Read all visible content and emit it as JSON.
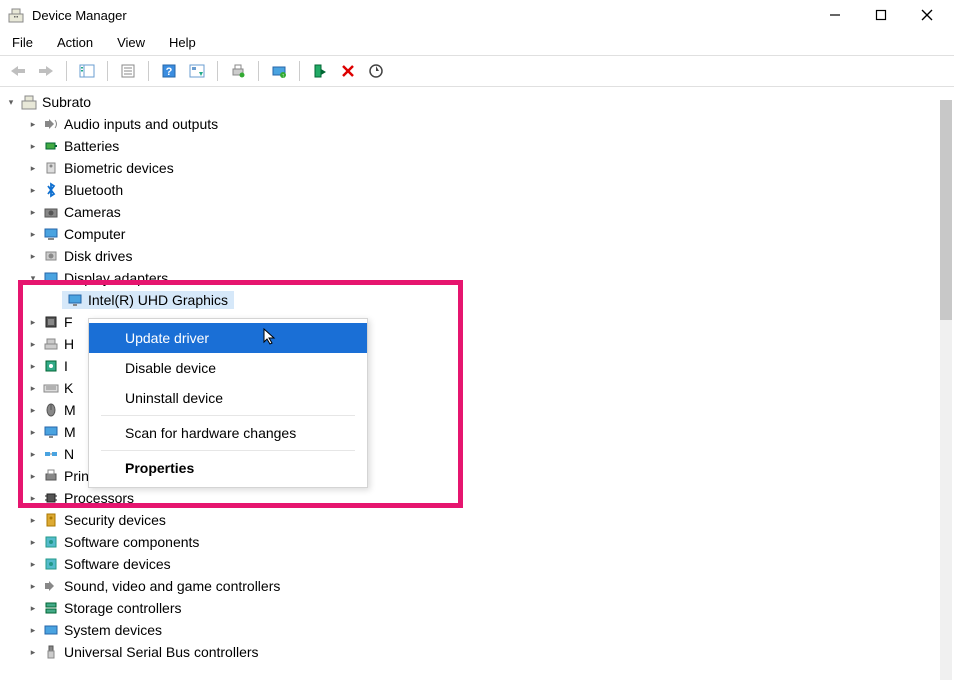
{
  "window": {
    "title": "Device Manager"
  },
  "menubar": [
    "File",
    "Action",
    "View",
    "Help"
  ],
  "tree": {
    "root": "Subrato",
    "selected_device": "Intel(R) UHD Graphics",
    "categories": [
      {
        "label": "Audio inputs and outputs",
        "icon": "audio"
      },
      {
        "label": "Batteries",
        "icon": "battery"
      },
      {
        "label": "Biometric devices",
        "icon": "biometric"
      },
      {
        "label": "Bluetooth",
        "icon": "bluetooth"
      },
      {
        "label": "Cameras",
        "icon": "camera"
      },
      {
        "label": "Computer",
        "icon": "computer"
      },
      {
        "label": "Disk drives",
        "icon": "disk"
      },
      {
        "label": "Display adapters",
        "icon": "display",
        "expanded": true
      },
      {
        "label": "F",
        "icon": "firmware",
        "partial": true
      },
      {
        "label": "H",
        "icon": "hid",
        "partial": true
      },
      {
        "label": "I",
        "icon": "imaging",
        "partial": true
      },
      {
        "label": "K",
        "icon": "keyboard",
        "partial": true
      },
      {
        "label": "M",
        "icon": "mouse",
        "partial": true
      },
      {
        "label": "M",
        "icon": "monitor",
        "partial": true
      },
      {
        "label": "N",
        "icon": "network",
        "partial": true
      },
      {
        "label": "Print queues",
        "icon": "printer"
      },
      {
        "label": "Processors",
        "icon": "processor"
      },
      {
        "label": "Security devices",
        "icon": "security"
      },
      {
        "label": "Software components",
        "icon": "software"
      },
      {
        "label": "Software devices",
        "icon": "software"
      },
      {
        "label": "Sound, video and game controllers",
        "icon": "sound"
      },
      {
        "label": "Storage controllers",
        "icon": "storage"
      },
      {
        "label": "System devices",
        "icon": "system"
      },
      {
        "label": "Universal Serial Bus controllers",
        "icon": "usb"
      }
    ]
  },
  "context_menu": {
    "items": [
      {
        "label": "Update driver",
        "hover": true
      },
      {
        "label": "Disable device"
      },
      {
        "label": "Uninstall device"
      },
      {
        "sep": true
      },
      {
        "label": "Scan for hardware changes"
      },
      {
        "sep": true
      },
      {
        "label": "Properties",
        "bold": true
      }
    ]
  }
}
